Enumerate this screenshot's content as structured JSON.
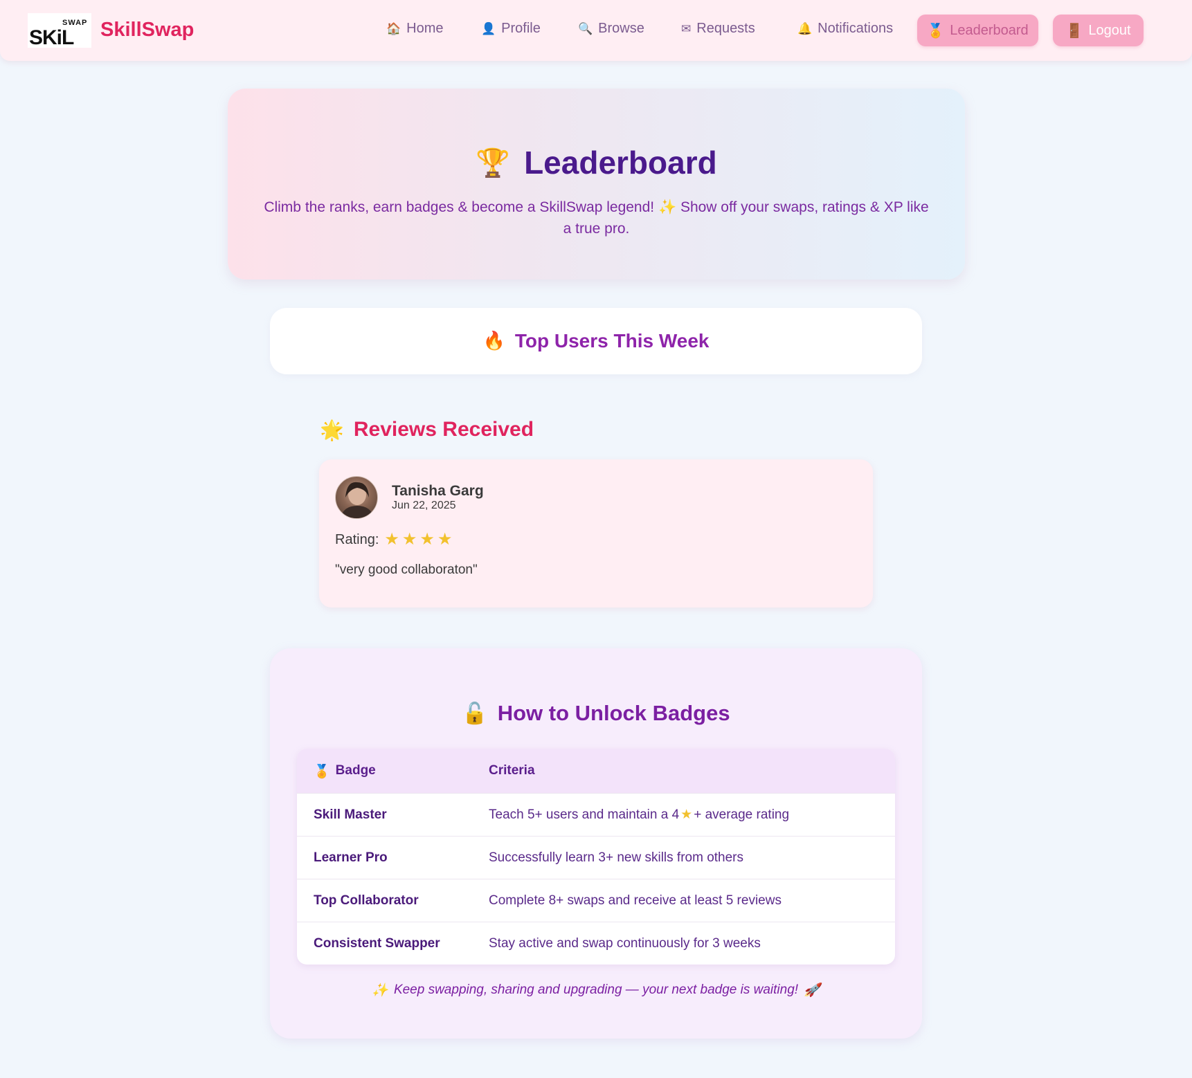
{
  "navbar": {
    "logo_text": "SKILL SWAP",
    "brand": "SkillSwap",
    "links": [
      {
        "icon": "house-icon",
        "label": "Home"
      },
      {
        "icon": "user-icon",
        "label": "Profile"
      },
      {
        "icon": "search-icon",
        "label": "Browse"
      },
      {
        "icon": "envelope-icon",
        "label": "Requests"
      },
      {
        "icon": "bell-icon",
        "label": "Notifications"
      }
    ],
    "leaderboard_label": "Leaderboard",
    "logout_label": "Logout"
  },
  "hero": {
    "title": "Leaderboard",
    "subtitle": "Climb the ranks, earn badges & become a SkillSwap legend! ✨ Show off your swaps, ratings & XP like a true pro."
  },
  "top_users": {
    "title": "Top Users This Week"
  },
  "reviews": {
    "title": "Reviews Received",
    "items": [
      {
        "name": "Tanisha Garg",
        "date": "Jun 22, 2025",
        "rating_label": "Rating:",
        "rating": 4,
        "text": "\"very good collaboraton\""
      }
    ]
  },
  "badges": {
    "title": "How to Unlock Badges",
    "columns": [
      "Badge",
      "Criteria"
    ],
    "rows": [
      {
        "badge": "Skill Master",
        "criteria_pre": "Teach 5+ users and maintain a 4",
        "criteria_post": "+ average rating"
      },
      {
        "badge": "Learner Pro",
        "criteria": "Successfully learn 3+ new skills from others"
      },
      {
        "badge": "Top Collaborator",
        "criteria": "Complete 8+ swaps and receive at least 5 reviews"
      },
      {
        "badge": "Consistent Swapper",
        "criteria": "Stay active and swap continuously for 3 weeks"
      }
    ],
    "footer": "Keep swapping, sharing and upgrading — your next badge is waiting!"
  },
  "colors": {
    "brand": "#e0245e",
    "purple_dark": "#4a1a8c",
    "purple": "#8e24aa",
    "pink_button": "#f7a8c4",
    "star": "#f2c12e"
  }
}
